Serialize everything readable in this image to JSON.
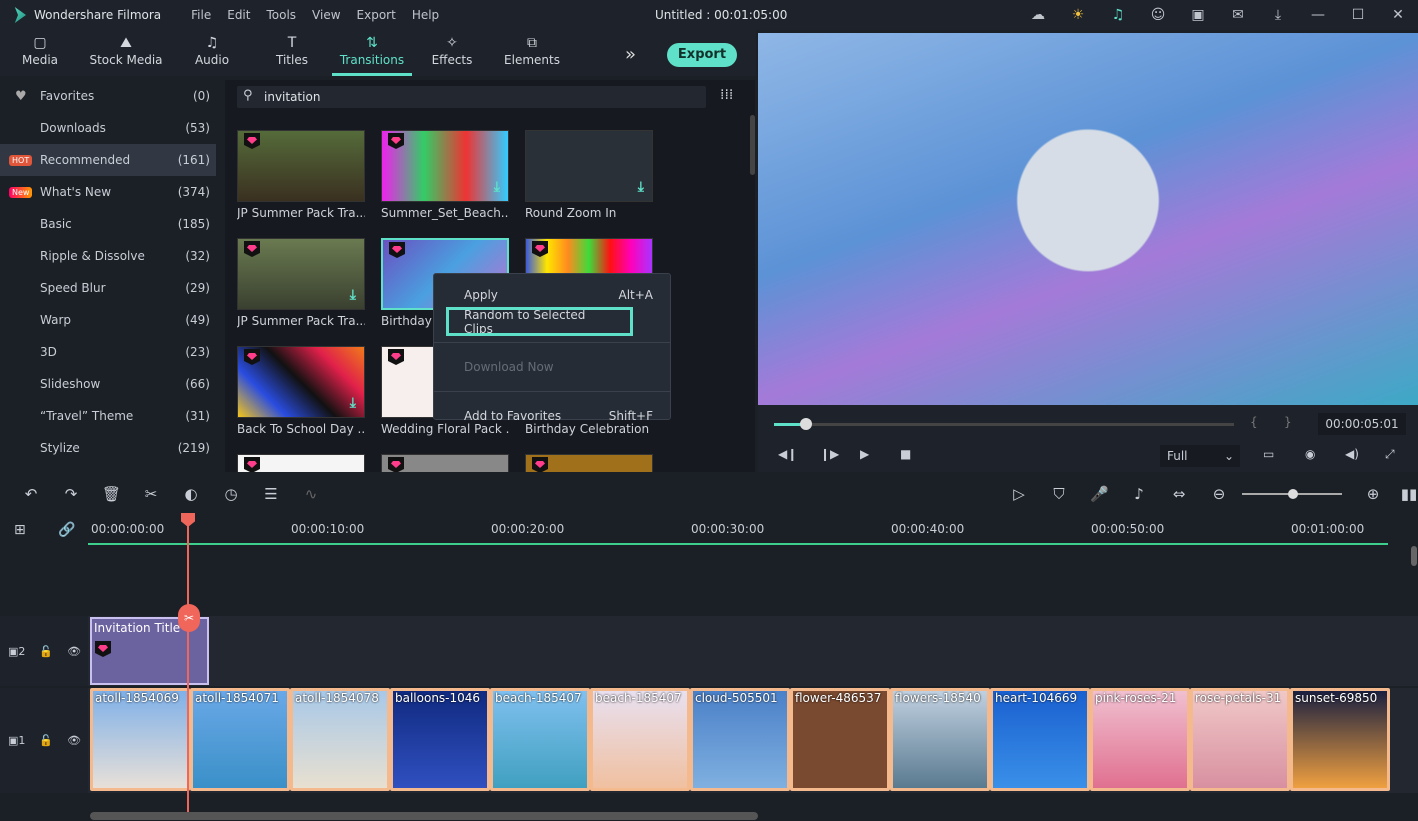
{
  "titlebar": {
    "app": "Wondershare Filmora",
    "menu": [
      "File",
      "Edit",
      "Tools",
      "View",
      "Export",
      "Help"
    ],
    "title": "Untitled : 00:01:05:00"
  },
  "tabs": [
    {
      "label": "Media",
      "icon": "folder-icon"
    },
    {
      "label": "Stock Media",
      "icon": "stock-icon"
    },
    {
      "label": "Audio",
      "icon": "music-icon"
    },
    {
      "label": "Titles",
      "icon": "text-icon"
    },
    {
      "label": "Transitions",
      "icon": "transition-icon",
      "active": true
    },
    {
      "label": "Effects",
      "icon": "effects-icon"
    },
    {
      "label": "Elements",
      "icon": "elements-icon"
    }
  ],
  "export_label": "Export",
  "sidebar": [
    {
      "label": "Favorites",
      "count": "(0)"
    },
    {
      "label": "Downloads",
      "count": "(53)"
    },
    {
      "label": "Recommended",
      "count": "(161)",
      "badge": "HOT",
      "active": true
    },
    {
      "label": "What's New",
      "count": "(374)",
      "badge": "New"
    },
    {
      "label": "Basic",
      "count": "(185)"
    },
    {
      "label": "Ripple & Dissolve",
      "count": "(32)"
    },
    {
      "label": "Speed Blur",
      "count": "(29)"
    },
    {
      "label": "Warp",
      "count": "(49)"
    },
    {
      "label": "3D",
      "count": "(23)"
    },
    {
      "label": "Slideshow",
      "count": "(66)"
    },
    {
      "label": "“Travel” Theme",
      "count": "(31)"
    },
    {
      "label": "Stylize",
      "count": "(219)"
    }
  ],
  "search": {
    "value": "invitation"
  },
  "tiles": [
    "JP Summer Pack Tra...",
    "Summer_Set_Beach...",
    "Round Zoom In",
    "JP Summer Pack Tra...",
    "Birthday C",
    "",
    "Back To School Day ...",
    "Wedding Floral Pack ...",
    "Birthday Celebration ...",
    "",
    "",
    ""
  ],
  "context_menu": [
    {
      "label": "Apply",
      "shortcut": "Alt+A"
    },
    {
      "label": "Random to Selected Clips",
      "shortcut": ""
    },
    {
      "label": "Download Now",
      "shortcut": "",
      "disabled": true
    },
    {
      "label": "Add to Favorites",
      "shortcut": "Shift+F"
    }
  ],
  "player": {
    "time": "00:00:05:01",
    "quality": "Full",
    "progress": 0.07
  },
  "ruler": [
    "00:00:00:00",
    "00:00:10:00",
    "00:00:20:00",
    "00:00:30:00",
    "00:00:40:00",
    "00:00:50:00",
    "00:01:00:00"
  ],
  "tracks": {
    "v2": "2",
    "v1": "1",
    "title_clip": "Invitation Title"
  },
  "clips": [
    "atoll-1854069",
    "atoll-1854071",
    "atoll-1854078",
    "balloons-1046",
    "beach-185407",
    "beach-185407",
    "cloud-505501",
    "flower-486537",
    "flowers-18540",
    "heart-104669",
    "pink-roses-21",
    "rose-petals-31",
    "sunset-69850"
  ],
  "colors": {
    "accent": "#5fe0c8",
    "playhead": "#f0665a",
    "clip_border": "#f4b98d",
    "title_clip": "#6b62a0"
  }
}
